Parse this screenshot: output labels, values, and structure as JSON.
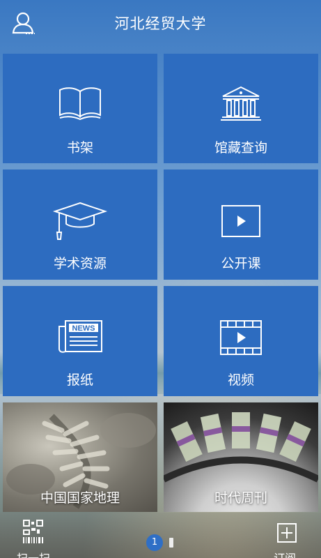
{
  "header": {
    "title": "河北经贸大学",
    "user_icon": "user-icon"
  },
  "tiles": [
    {
      "label": "书架",
      "icon": "book-icon"
    },
    {
      "label": "馆藏查询",
      "icon": "library-building-icon"
    },
    {
      "label": "学术资源",
      "icon": "graduation-cap-icon"
    },
    {
      "label": "公开课",
      "icon": "play-icon"
    },
    {
      "label": "报纸",
      "icon": "newspaper-icon",
      "icon_text": "NEWS"
    },
    {
      "label": "视频",
      "icon": "film-play-icon"
    },
    {
      "label": "中国国家地理",
      "icon": "fossil-photo"
    },
    {
      "label": "时代周刊",
      "icon": "money-photo"
    }
  ],
  "bottom": {
    "scan_label": "扫一扫",
    "subscribe_label": "订阅",
    "page_current": "1"
  },
  "colors": {
    "tile_blue": "#2d6cc0",
    "pager_active": "#2f6fc6"
  }
}
